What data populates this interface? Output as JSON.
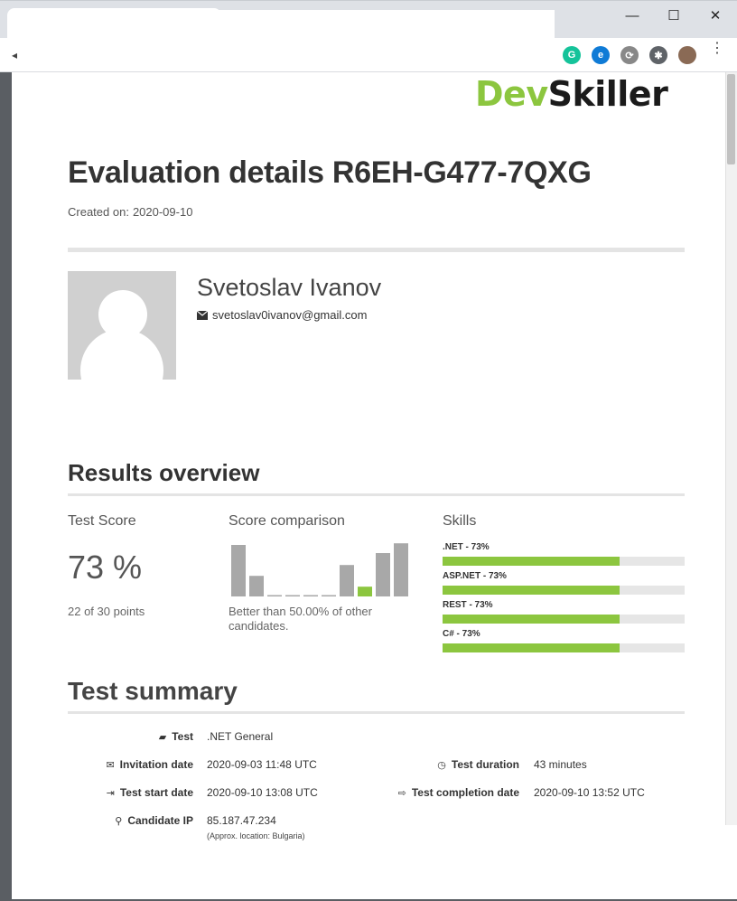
{
  "browser": {
    "window_controls": {
      "minimize": "—",
      "maximize": "☐",
      "close": "✕"
    },
    "extensions": [
      {
        "name": "grammarly-icon",
        "glyph": "G",
        "color": "#15c39a"
      },
      {
        "name": "edge-icon",
        "glyph": "e",
        "color": "#0f7bd6"
      },
      {
        "name": "refresh-extension-icon",
        "glyph": "⟳",
        "color": "#888888"
      },
      {
        "name": "puzzle-icon",
        "glyph": "✱",
        "color": "#5f6368"
      }
    ],
    "menu": "⋮"
  },
  "logo": {
    "part1": "Dev",
    "part2": "Skiller"
  },
  "header": {
    "title": "Evaluation details R6EH-G477-7QXG",
    "created_label": "Created on:",
    "created_date": "2020-09-10"
  },
  "candidate": {
    "name": "Svetoslav Ivanov",
    "email": "svetoslav0ivanov@gmail.com"
  },
  "results": {
    "heading": "Results overview",
    "test_score_label": "Test Score",
    "test_score": "73 %",
    "points": "22 of 30 points",
    "comparison_label": "Score comparison",
    "comparison_text": "Better than 50.00% of other candidates.",
    "comparison_bars": [
      0.95,
      0.38,
      0.02,
      0.02,
      0.02,
      0.02,
      0.58,
      0.18,
      0.8,
      0.98
    ],
    "highlight_index": 7,
    "skills_label": "Skills",
    "skills": [
      {
        "label": ".NET - 73%",
        "value": 0.73
      },
      {
        "label": "ASP.NET - 73%",
        "value": 0.73
      },
      {
        "label": "REST - 73%",
        "value": 0.73
      },
      {
        "label": "C# - 73%",
        "value": 0.73
      }
    ]
  },
  "summary": {
    "heading": "Test summary",
    "test_label": "Test",
    "test_value": ".NET General",
    "invitation_label": "Invitation date",
    "invitation_value": "2020-09-03 11:48 UTC",
    "duration_label": "Test duration",
    "duration_value": "43 minutes",
    "start_label": "Test start date",
    "start_value": "2020-09-10 13:08 UTC",
    "completion_label": "Test completion date",
    "completion_value": "2020-09-10 13:52 UTC",
    "ip_label": "Candidate IP",
    "ip_value": "85.187.47.234",
    "ip_location": "(Approx. location: Bulgaria)"
  },
  "colors": {
    "accent": "#8cc63f",
    "bar_gray": "#a8a8a8",
    "track": "#e6e6e6"
  }
}
